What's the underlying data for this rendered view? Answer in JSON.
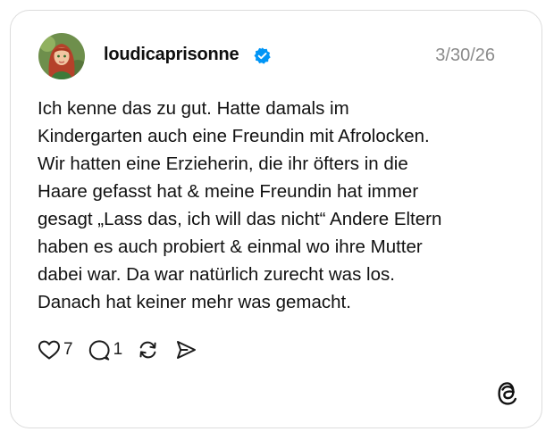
{
  "post": {
    "username": "loudicaprisonne",
    "verified": true,
    "date": "3/30/26",
    "text": "Ich kenne das zu gut. Hatte damals im\nKindergarten auch eine Freundin mit Afrolocken.\nWir hatten eine Erzieherin, die ihr öfters in die\nHaare gefasst hat & meine Freundin hat immer\ngesagt „Lass das, ich will das nicht“ Andere Eltern\nhaben es auch probiert & einmal wo ihre Mutter\ndabei war. Da war natürlich zurecht was los.\nDanach hat keiner mehr was gemacht."
  },
  "actions": {
    "likes": "7",
    "replies": "1"
  },
  "icons": {
    "avatar": "avatar-image",
    "verified": "verified-badge-icon",
    "like": "heart-icon",
    "reply": "speech-bubble-icon",
    "repost": "repost-icon",
    "share": "send-icon",
    "brand": "threads-logo-icon"
  },
  "colors": {
    "verified_blue": "#0095f6",
    "date_gray": "#8a8a8a",
    "border": "#dcdcdc"
  }
}
